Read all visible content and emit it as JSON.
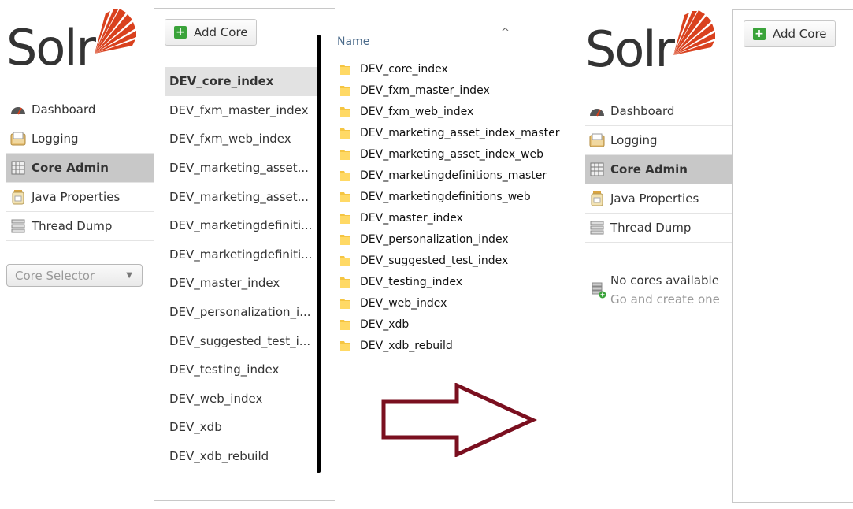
{
  "left": {
    "logo_text": "Solr",
    "nav": [
      {
        "label": "Dashboard",
        "icon": "dashboard-icon"
      },
      {
        "label": "Logging",
        "icon": "logging-icon"
      },
      {
        "label": "Core Admin",
        "icon": "core-admin-icon",
        "active": true
      },
      {
        "label": "Java Properties",
        "icon": "java-properties-icon"
      },
      {
        "label": "Thread Dump",
        "icon": "thread-dump-icon"
      }
    ],
    "core_selector": "Core Selector",
    "add_core_label": "Add Core",
    "cores": [
      "DEV_core_index",
      "DEV_fxm_master_index",
      "DEV_fxm_web_index",
      "DEV_marketing_asset...",
      "DEV_marketing_asset...",
      "DEV_marketingdefiniti...",
      "DEV_marketingdefiniti...",
      "DEV_master_index",
      "DEV_personalization_i...",
      "DEV_suggested_test_i...",
      "DEV_testing_index",
      "DEV_web_index",
      "DEV_xdb",
      "DEV_xdb_rebuild"
    ]
  },
  "explorer": {
    "column_header": "Name",
    "sort_indicator": "^",
    "folders": [
      "DEV_core_index",
      "DEV_fxm_master_index",
      "DEV_fxm_web_index",
      "DEV_marketing_asset_index_master",
      "DEV_marketing_asset_index_web",
      "DEV_marketingdefinitions_master",
      "DEV_marketingdefinitions_web",
      "DEV_master_index",
      "DEV_personalization_index",
      "DEV_suggested_test_index",
      "DEV_testing_index",
      "DEV_web_index",
      "DEV_xdb",
      "DEV_xdb_rebuild"
    ]
  },
  "right": {
    "logo_text": "Solr",
    "nav": [
      {
        "label": "Dashboard",
        "icon": "dashboard-icon"
      },
      {
        "label": "Logging",
        "icon": "logging-icon"
      },
      {
        "label": "Core Admin",
        "icon": "core-admin-icon",
        "active": true
      },
      {
        "label": "Java Properties",
        "icon": "java-properties-icon"
      },
      {
        "label": "Thread Dump",
        "icon": "thread-dump-icon"
      }
    ],
    "add_core_label": "Add Core",
    "no_cores_text": "No cores available",
    "create_link": "Go and create one"
  },
  "colors": {
    "logo_red": "#d9411e",
    "arrow": "#7a0f1f",
    "active_nav": "#c8c8c8"
  }
}
